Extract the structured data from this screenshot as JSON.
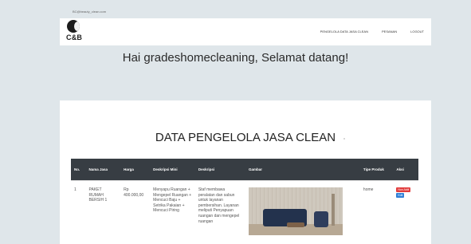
{
  "header": {
    "email": "BC@beauty_clean.com",
    "logo_text": "C&B",
    "nav": [
      "PENGELOLA DATA JASA CLEAN",
      "PESANAN",
      "LOGOUT"
    ]
  },
  "welcome": "Hai gradeshomecleaning, Selamat datang!",
  "card": {
    "title": "DATA PENGELOLA JASA CLEAN"
  },
  "table": {
    "headers": [
      "No.",
      "Nama Jasa",
      "Harga",
      "Deskripsi Mini",
      "Deskripsi",
      "Gambar",
      "Tipe Produk",
      "Aksi"
    ],
    "rows": [
      {
        "no": "1",
        "nama_jasa": "PAKET RUMAH BERSIH 1",
        "harga": "Rp 400.000,00",
        "deskripsi_mini": "Menyapu Ruangan + Mengepel Ruangan + Mencuci Baju + Setrika Pakaian + Mencuci Piring",
        "deskripsi": "Staf membawa peralatan dan sabun untuk layanan pembersihan. Layanan meliputi Penyapuan ruangan dan mengepel ruangan",
        "tipe_produk": "home",
        "aksi": [
          "Non Aktif",
          "Edit"
        ]
      }
    ]
  },
  "colors": {
    "page_bg": "#dfe6ea",
    "table_header": "#373d43",
    "badge_nonaktif": "#e23d3d",
    "badge_edit": "#2f7fd6"
  }
}
